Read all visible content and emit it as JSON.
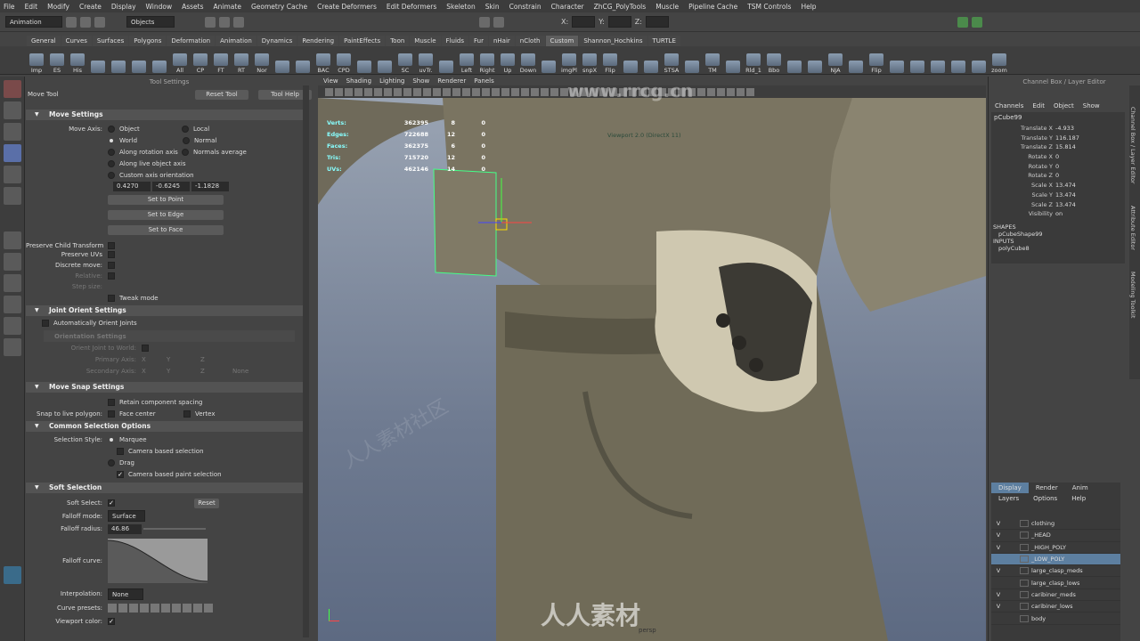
{
  "menubar": [
    "File",
    "Edit",
    "Modify",
    "Create",
    "Display",
    "Window",
    "Assets",
    "Animate",
    "Geometry Cache",
    "Create Deformers",
    "Edit Deformers",
    "Skeleton",
    "Skin",
    "Constrain",
    "Character",
    "ZhCG_PolyTools",
    "Muscle",
    "Pipeline Cache",
    "TSM Controls",
    "Help"
  ],
  "status": {
    "mode": "Animation",
    "objects": "Objects",
    "x": "X:",
    "y": "Y:",
    "z": "Z:"
  },
  "shelf_tabs": [
    "General",
    "Curves",
    "Surfaces",
    "Polygons",
    "Deformation",
    "Animation",
    "Dynamics",
    "Rendering",
    "PaintEffects",
    "Toon",
    "Muscle",
    "Fluids",
    "Fur",
    "nHair",
    "nCloth",
    "Custom",
    "Shannon_Hochkins",
    "TURTLE"
  ],
  "shelf_active": "Custom",
  "shelf_buttons": [
    "Imp",
    "ES",
    "His",
    "",
    "",
    "",
    "",
    "All",
    "CP",
    "FT",
    "RT",
    "Nor",
    "",
    "",
    "BAC",
    "CPD",
    "",
    "",
    "SC",
    "uvTr.",
    "",
    "Left",
    "Right",
    "Up",
    "Down",
    "",
    "imgPl",
    "snpX",
    "Flip",
    "",
    "",
    "STSA",
    "",
    "TM",
    "",
    "Rld_1",
    "Bbo",
    "",
    "",
    "NJA",
    "",
    "Flip",
    "",
    "",
    "",
    "",
    "",
    "zoom"
  ],
  "tool": {
    "header": "Tool Settings",
    "name": "Move Tool",
    "reset": "Reset Tool",
    "help": "Tool Help",
    "move_settings": "Move Settings",
    "move_axis": "Move Axis:",
    "object": "Object",
    "local": "Local",
    "world": "World",
    "normal": "Normal",
    "along_rot": "Along rotation axis",
    "normal_avg": "Normals average",
    "along_live": "Along live object axis",
    "custom_axis": "Custom axis orientation",
    "v1": "0.4270",
    "v2": "-0.6245",
    "v3": "-1.1828",
    "set_point": "Set to Point",
    "set_edge": "Set to Edge",
    "set_face": "Set to Face",
    "preserve_child": "Preserve Child Transform",
    "preserve_uvs": "Preserve UVs",
    "discrete": "Discrete move:",
    "relative": "Relative:",
    "step": "Step size:",
    "tweak": "Tweak mode",
    "joint_orient": "Joint Orient Settings",
    "auto_orient": "Automatically Orient Joints",
    "orient_settings": "Orientation Settings",
    "orient_world": "Orient Joint to World:",
    "primary": "Primary Axis:",
    "secondary": "Secondary Axis:",
    "none": "None",
    "x": "X",
    "y": "Y",
    "z": "Z",
    "move_snap": "Move Snap Settings",
    "retain": "Retain component spacing",
    "snap_live": "Snap to live polygon:",
    "face_center": "Face center",
    "vertex": "Vertex",
    "common_sel": "Common Selection Options",
    "sel_style": "Selection Style:",
    "marquee": "Marquee",
    "camera_based": "Camera based selection",
    "drag": "Drag",
    "camera_paint": "Camera based paint selection",
    "soft_sel": "Soft Selection",
    "soft_select": "Soft Select:",
    "reset_btn": "Reset",
    "falloff_mode": "Falloff mode:",
    "surface": "Surface",
    "falloff_radius": "Falloff radius:",
    "radius": "46.86",
    "falloff_curve": "Falloff curve:",
    "interp": "Interpolation:",
    "interp_val": "None",
    "curve_presets": "Curve presets:",
    "viewport_color": "Viewport color:"
  },
  "viewport": {
    "menu": [
      "View",
      "Shading",
      "Lighting",
      "Show",
      "Renderer",
      "Panels"
    ],
    "hud": [
      {
        "k": "Verts:",
        "v": "362395",
        "s": "8",
        "t": "0"
      },
      {
        "k": "Edges:",
        "v": "722688",
        "s": "12",
        "t": "0"
      },
      {
        "k": "Faces:",
        "v": "362375",
        "s": "6",
        "t": "0"
      },
      {
        "k": "Tris:",
        "v": "715720",
        "s": "12",
        "t": "0"
      },
      {
        "k": "UVs:",
        "v": "462146",
        "s": "14",
        "t": "0"
      }
    ],
    "label": "Viewport 2.0 (DirectX 11)",
    "bottom": "persp"
  },
  "channel": {
    "header": "Channel Box / Layer Editor",
    "menu": [
      "Channels",
      "Edit",
      "Object",
      "Show"
    ],
    "object": "pCube99",
    "attrs": [
      {
        "n": "Translate X",
        "v": "-4.933"
      },
      {
        "n": "Translate Y",
        "v": "116.187"
      },
      {
        "n": "Translate Z",
        "v": "15.814"
      },
      {
        "n": "Rotate X",
        "v": "0"
      },
      {
        "n": "Rotate Y",
        "v": "0"
      },
      {
        "n": "Rotate Z",
        "v": "0"
      },
      {
        "n": "Scale X",
        "v": "13.474"
      },
      {
        "n": "Scale Y",
        "v": "13.474"
      },
      {
        "n": "Scale Z",
        "v": "13.474"
      },
      {
        "n": "Visibility",
        "v": "on"
      }
    ],
    "shapes": "SHAPES",
    "shape": "pCubeShape99",
    "inputs": "INPUTS",
    "input": "polyCube8",
    "side_tabs": [
      "Channel Box / Layer Editor",
      "Attribute Editor",
      "Modeling Toolkit"
    ]
  },
  "layers": {
    "tabs": [
      "Display",
      "Render",
      "Anim"
    ],
    "menu": [
      "Layers",
      "Options",
      "Help"
    ],
    "rows": [
      {
        "v": "V",
        "name": "clothing"
      },
      {
        "v": "V",
        "name": "_HEAD"
      },
      {
        "v": "V",
        "name": "_HIGH_POLY"
      },
      {
        "v": "",
        "name": "_LOW_POLY",
        "sel": true
      },
      {
        "v": "V",
        "name": "large_clasp_meds"
      },
      {
        "v": "",
        "name": "large_clasp_lows"
      },
      {
        "v": "V",
        "name": "caribiner_meds"
      },
      {
        "v": "V",
        "name": "caribiner_lows"
      },
      {
        "v": "",
        "name": "body"
      }
    ]
  },
  "watermark": {
    "url": "www.rrcg.cn",
    "brand": "人人素材",
    "repeat": "人人素材社区"
  }
}
